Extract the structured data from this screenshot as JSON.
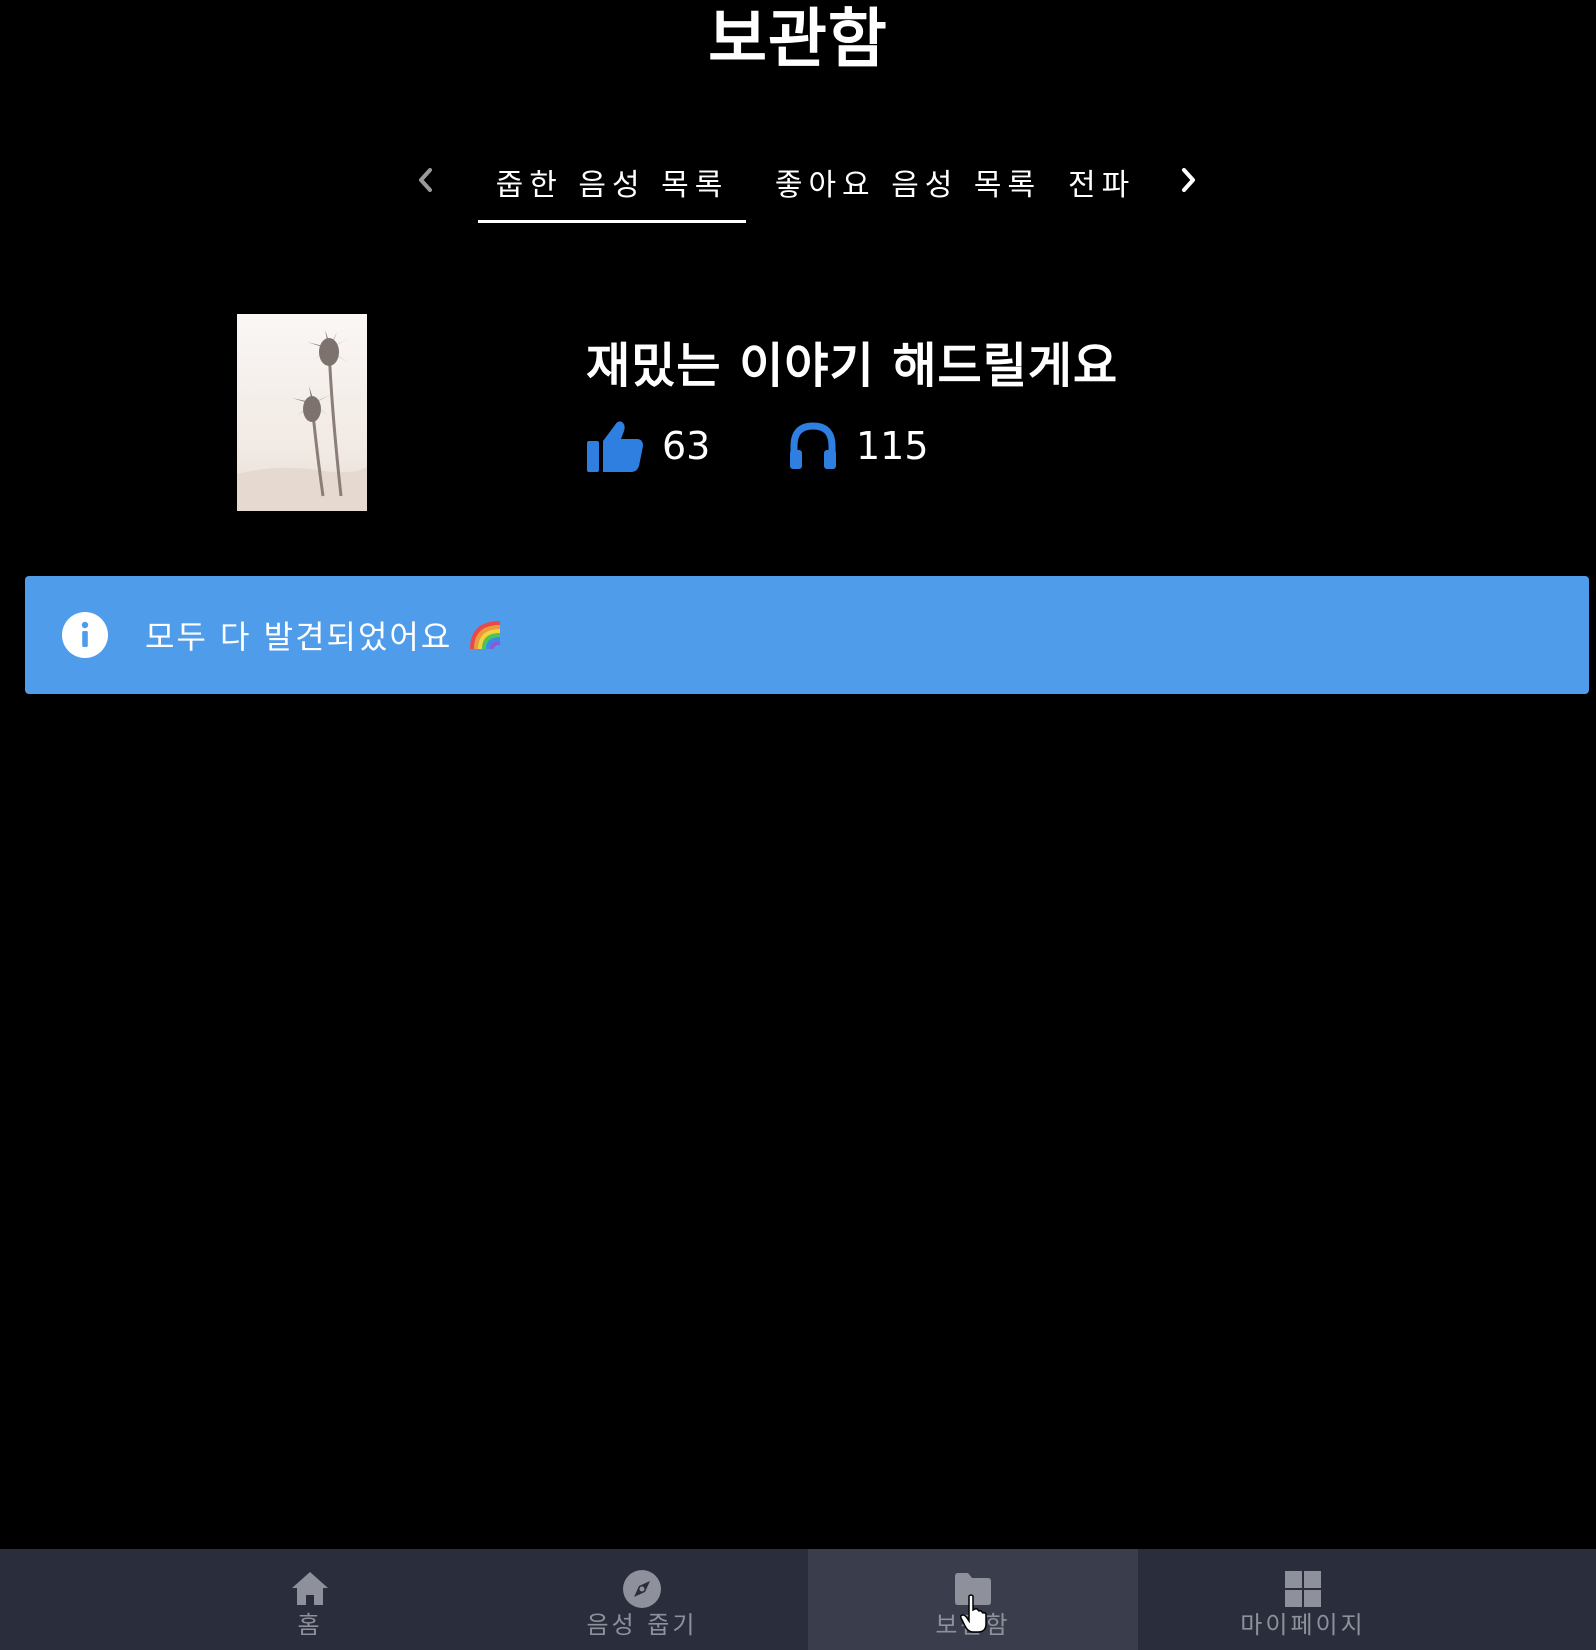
{
  "header": {
    "title": "보관함"
  },
  "tabs": [
    {
      "label": "줍한 음성 목록",
      "active": true
    },
    {
      "label": "좋아요 음성 목록",
      "active": false
    },
    {
      "label": "전파",
      "active": false
    }
  ],
  "tab_arrows": {
    "left_icon": "chevron-left-icon",
    "right_icon": "chevron-right-icon"
  },
  "items": [
    {
      "title": "재밌는 이야기 해드릴게요",
      "likes": "63",
      "listens": "115",
      "like_icon": "thumbs-up-icon",
      "listen_icon": "headphones-icon"
    }
  ],
  "alert": {
    "text": "모두 다 발견되었어요",
    "icon": "info-icon",
    "emoji": "rainbow-icon",
    "color": "#4f9ceb"
  },
  "bottom_nav": [
    {
      "label": "홈",
      "icon": "home-icon",
      "active": false
    },
    {
      "label": "음성 줍기",
      "icon": "compass-icon",
      "active": false
    },
    {
      "label": "보관함",
      "icon": "folder-icon",
      "active": true
    },
    {
      "label": "마이페이지",
      "icon": "grid-icon",
      "active": false
    }
  ],
  "colors": {
    "background": "#000000",
    "accent_blue": "#2f7fe0",
    "nav_background": "#2a2d3b",
    "nav_active_background": "#3a3d4b",
    "nav_text": "#8e909c"
  }
}
